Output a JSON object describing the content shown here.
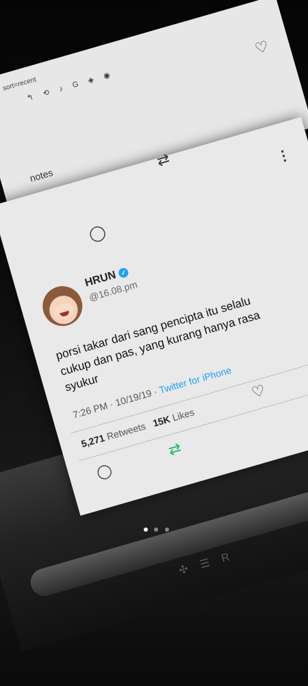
{
  "back_card": {
    "url_text": "sort=recent",
    "toolbar_icons": [
      "back-arrow-icon",
      "refresh-icon",
      "tiktok-icon",
      "google-icon",
      "bookmark-icon",
      "github-icon"
    ],
    "notes_label": "notes"
  },
  "tweet": {
    "name": "HRUN",
    "handle": "@16.08.pm",
    "text": "porsi takar dari sang pencipta itu selalu cukup dan pas, yang kurang hanya rasa syukur",
    "time": "7:26 PM · 10/19/19 ·",
    "source": "Twitter for iPhone",
    "retweets_count": "5,271",
    "retweets_label": "Retweets",
    "likes_count": "15K",
    "likes_label": "Likes"
  },
  "carousel": {
    "pages": 3,
    "active_index": 0
  },
  "colors": {
    "verified": "#1da1f2",
    "source_link": "#1da1f2",
    "retweet_active": "#17bf63"
  }
}
